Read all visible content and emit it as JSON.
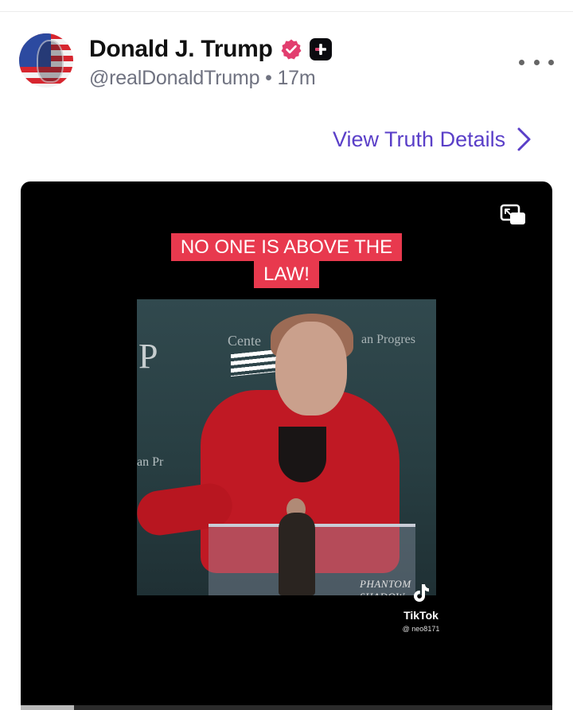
{
  "post": {
    "author_name": "Donald J. Trump",
    "handle": "@realDonaldTrump",
    "separator": "•",
    "time": "17m",
    "view_details_label": "View Truth Details"
  },
  "icons": {
    "verified": "verified-badge-icon",
    "plus_badge": "plus-badge-icon",
    "more": "more-options-icon",
    "chevron": "chevron-right-icon",
    "pip": "picture-in-picture-icon",
    "tiktok": "tiktok-logo-icon"
  },
  "video": {
    "caption_line1": "NO ONE IS ABOVE THE",
    "caption_line2": "LAW!",
    "banner_left": "Cente",
    "banner_right": "an Progres",
    "banner_letter": "P",
    "side_text": "an Pr",
    "watermark": "PHANTOM SHADOW",
    "tiktok_label": "TikTok",
    "tiktok_user": "@ neo8171",
    "progress": 0.1
  },
  "colors": {
    "accent": "#5a3fc8",
    "verified": "#e23d6e",
    "caption_bg": "#e8394e"
  }
}
